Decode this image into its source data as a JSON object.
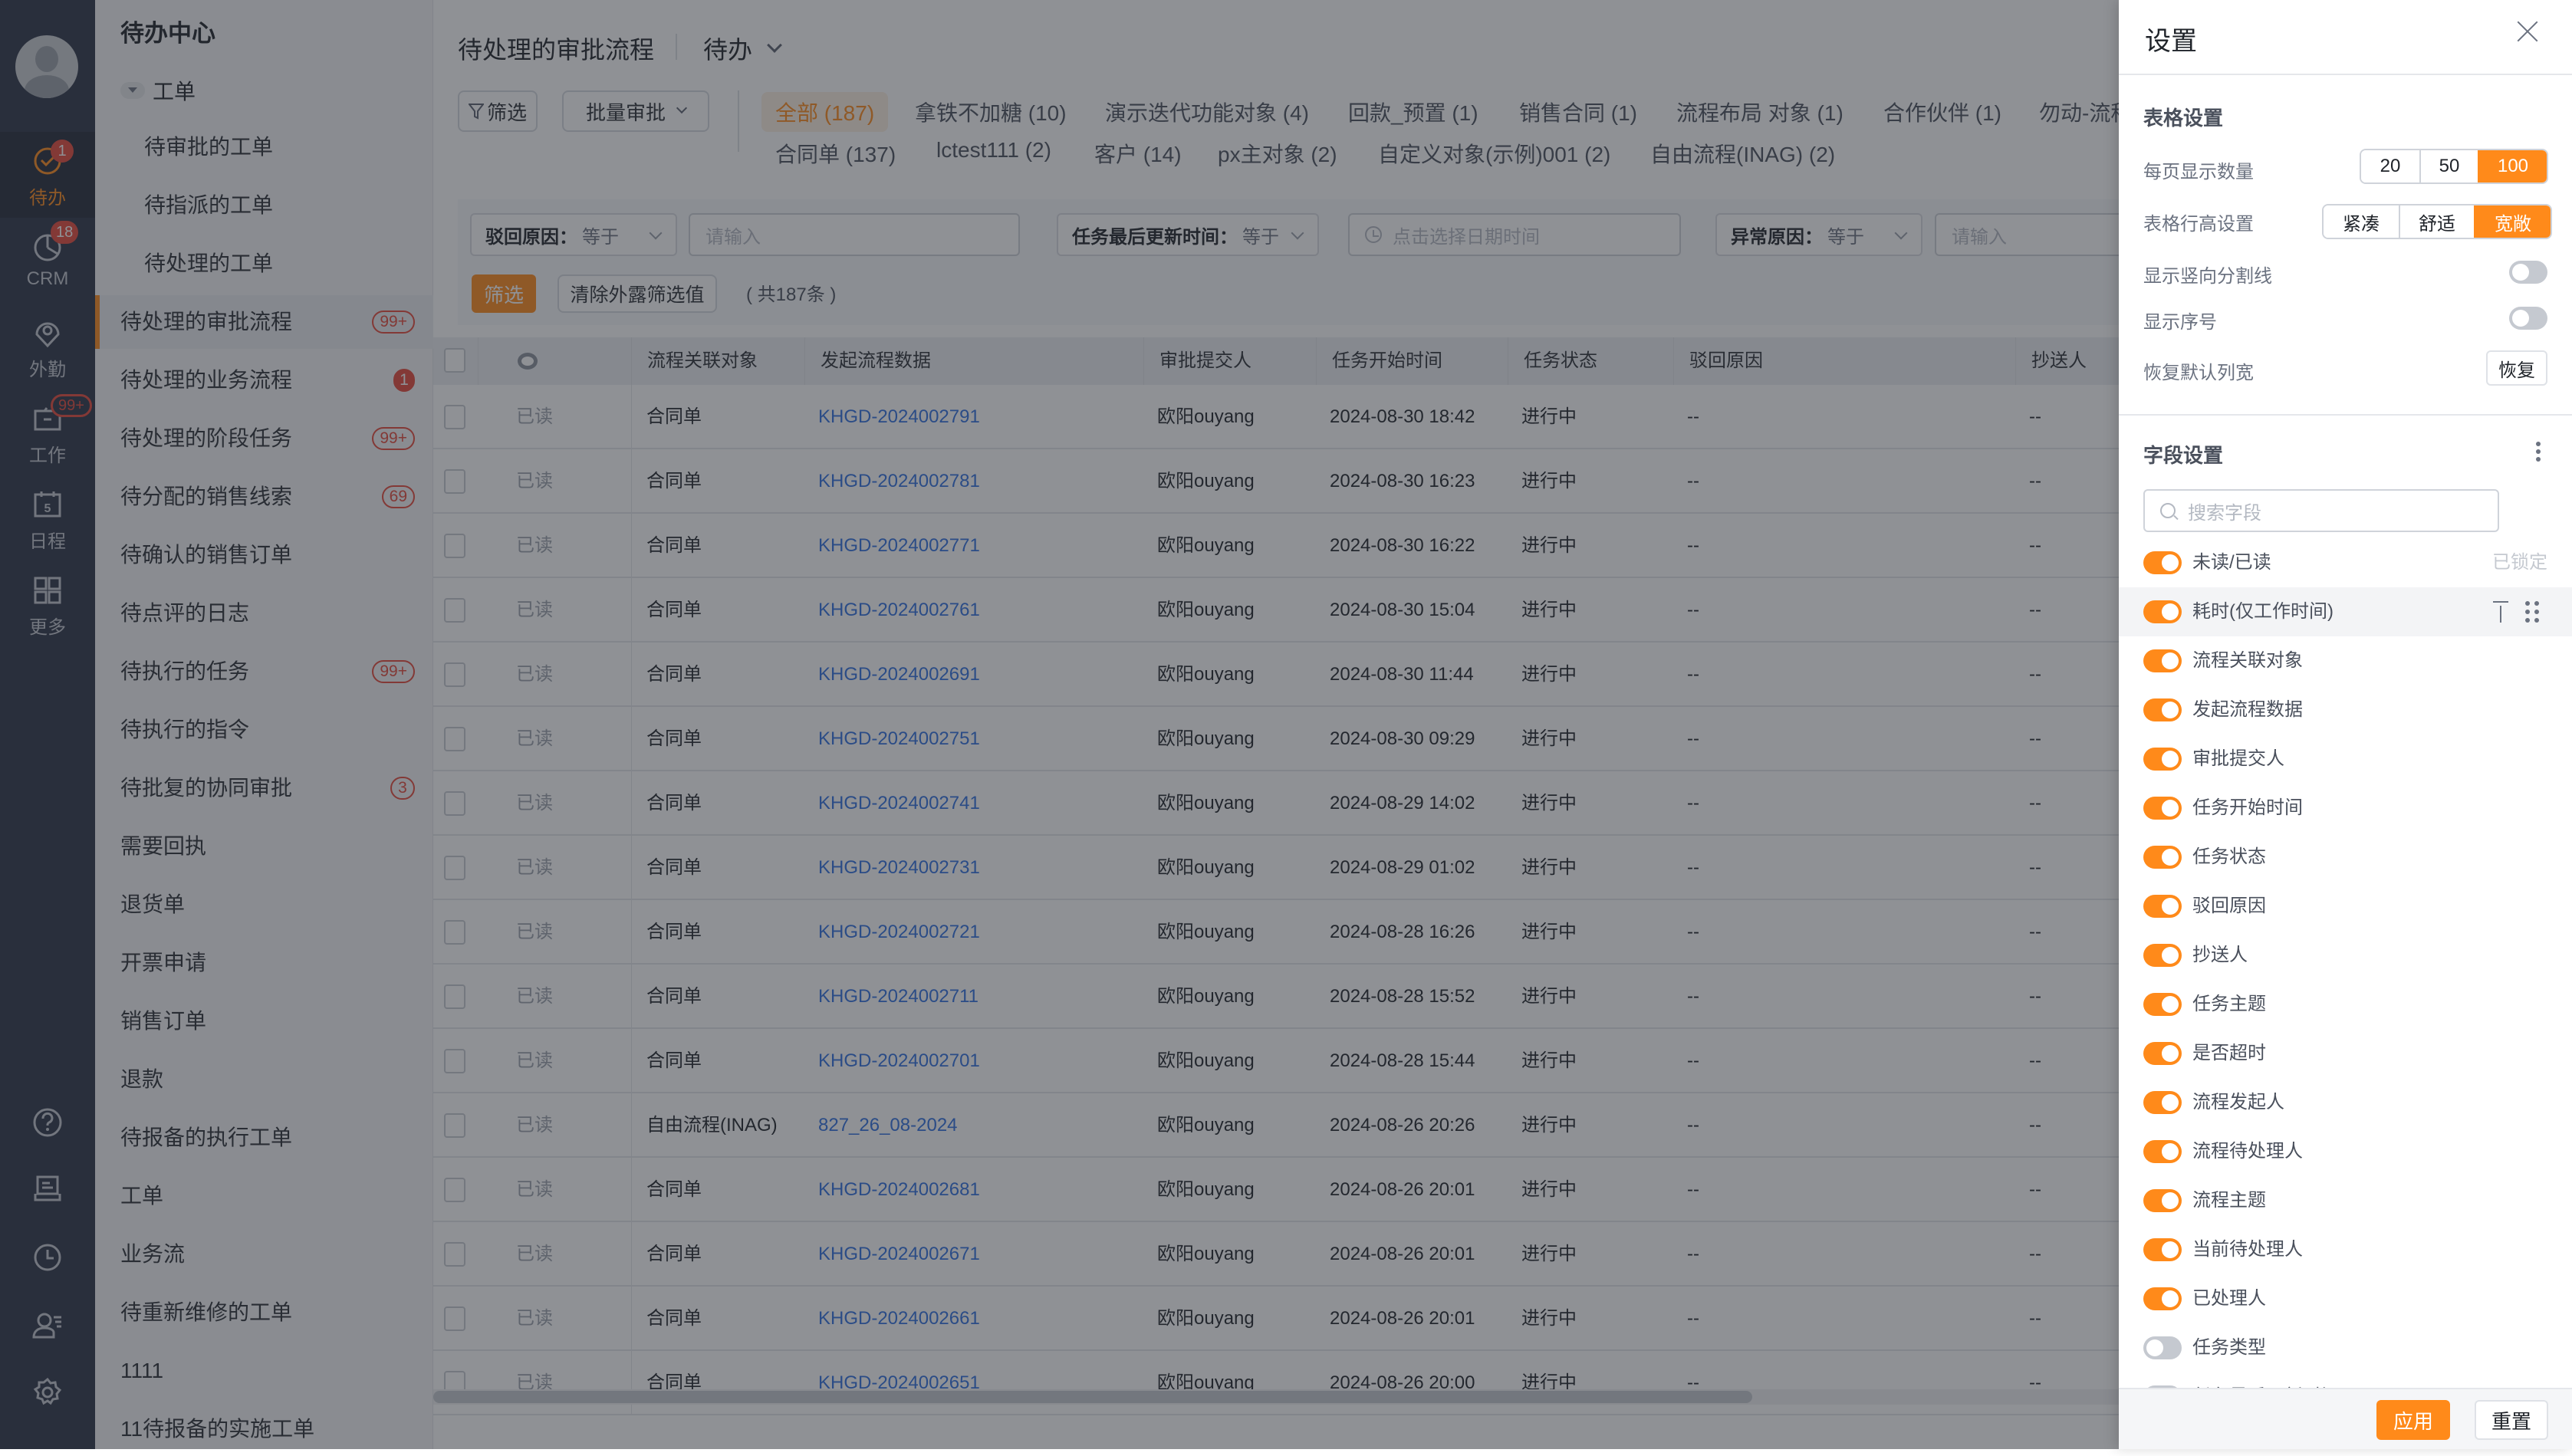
{
  "rail": {
    "items": [
      {
        "label": "待办",
        "icon": "check-circle-icon",
        "badge": "1",
        "active": true
      },
      {
        "label": "CRM",
        "icon": "pie-chart-icon",
        "badge": "18"
      },
      {
        "label": "外勤",
        "icon": "location-pin-icon",
        "badge": null
      },
      {
        "label": "工作",
        "icon": "briefcase-icon",
        "badge": "99+"
      },
      {
        "label": "日程",
        "icon": "calendar-icon",
        "badge": null,
        "calendar_day": "5"
      },
      {
        "label": "更多",
        "icon": "grid-icon",
        "badge": null
      }
    ],
    "bottom_icons": [
      "help-icon",
      "inbox-icon",
      "history-clock-icon",
      "contacts-icon",
      "settings-gear-icon"
    ]
  },
  "nav": {
    "title": "待办中心",
    "group": "工单",
    "sub_items": [
      "待审批的工单",
      "待指派的工单",
      "待处理的工单"
    ],
    "items": [
      {
        "label": "待处理的审批流程",
        "badge": "99+",
        "active": true
      },
      {
        "label": "待处理的业务流程",
        "badge": "1",
        "solid": true
      },
      {
        "label": "待处理的阶段任务",
        "badge": "99+"
      },
      {
        "label": "待分配的销售线索",
        "badge": "69"
      },
      {
        "label": "待确认的销售订单",
        "badge": null
      },
      {
        "label": "待点评的日志",
        "badge": null
      },
      {
        "label": "待执行的任务",
        "badge": "99+"
      },
      {
        "label": "待执行的指令",
        "badge": null
      },
      {
        "label": "待批复的协同审批",
        "badge": "3"
      },
      {
        "label": "需要回执",
        "badge": null
      },
      {
        "label": "退货单",
        "badge": null
      },
      {
        "label": "开票申请",
        "badge": null
      },
      {
        "label": "销售订单",
        "badge": null
      },
      {
        "label": "退款",
        "badge": null
      },
      {
        "label": "待报备的执行工单",
        "badge": null
      },
      {
        "label": "工单",
        "badge": null
      },
      {
        "label": "业务流",
        "badge": null
      },
      {
        "label": "待重新维修的工单",
        "badge": null
      },
      {
        "label": "1111",
        "badge": null
      },
      {
        "label": "11待报备的实施工单",
        "badge": null
      }
    ]
  },
  "header": {
    "title": "待处理的审批流程",
    "view": "待办"
  },
  "toolbar": {
    "filter_label": "筛选",
    "batch_label": "批量审批"
  },
  "tabs": {
    "row1": [
      "全部 (187)",
      "拿铁不加糖 (10)",
      "演示迭代功能对象 (4)",
      "回款_预置 (1)",
      "销售合同 (1)",
      "流程布局 对象 (1)",
      "合作伙伴 (1)",
      "勿动-流程"
    ],
    "row2": [
      "合同单 (137)",
      "lctest111 (2)",
      "客户 (14)",
      "px主对象 (2)",
      "自定义对象(示例)001 (2)",
      "自由流程(INAG) (2)"
    ]
  },
  "filters": {
    "f1": {
      "field": "驳回原因：",
      "op": "等于",
      "placeholder": "请输入"
    },
    "f2": {
      "field": "任务最后更新时间：",
      "op": "等于",
      "placeholder": "点击选择日期时间"
    },
    "f3": {
      "field": "异常原因：",
      "op": "等于",
      "placeholder": "请输入"
    },
    "apply_label": "筛选",
    "clear_label": "清除外露筛选值",
    "total": "( 共187条 )"
  },
  "table": {
    "columns": [
      "流程关联对象",
      "发起流程数据",
      "审批提交人",
      "任务开始时间",
      "任务状态",
      "驳回原因",
      "抄送人"
    ],
    "rows": [
      {
        "read": "已读",
        "object": "合同单",
        "data": "KHGD-2024002791",
        "submitter": "欧阳ouyang",
        "start": "2024-08-30 18:42",
        "status": "进行中",
        "reason": "--",
        "cc": "--"
      },
      {
        "read": "已读",
        "object": "合同单",
        "data": "KHGD-2024002781",
        "submitter": "欧阳ouyang",
        "start": "2024-08-30 16:23",
        "status": "进行中",
        "reason": "--",
        "cc": "--"
      },
      {
        "read": "已读",
        "object": "合同单",
        "data": "KHGD-2024002771",
        "submitter": "欧阳ouyang",
        "start": "2024-08-30 16:22",
        "status": "进行中",
        "reason": "--",
        "cc": "--"
      },
      {
        "read": "已读",
        "object": "合同单",
        "data": "KHGD-2024002761",
        "submitter": "欧阳ouyang",
        "start": "2024-08-30 15:04",
        "status": "进行中",
        "reason": "--",
        "cc": "--"
      },
      {
        "read": "已读",
        "object": "合同单",
        "data": "KHGD-2024002691",
        "submitter": "欧阳ouyang",
        "start": "2024-08-30 11:44",
        "status": "进行中",
        "reason": "--",
        "cc": "--"
      },
      {
        "read": "已读",
        "object": "合同单",
        "data": "KHGD-2024002751",
        "submitter": "欧阳ouyang",
        "start": "2024-08-30 09:29",
        "status": "进行中",
        "reason": "--",
        "cc": "--"
      },
      {
        "read": "已读",
        "object": "合同单",
        "data": "KHGD-2024002741",
        "submitter": "欧阳ouyang",
        "start": "2024-08-29 14:02",
        "status": "进行中",
        "reason": "--",
        "cc": "--"
      },
      {
        "read": "已读",
        "object": "合同单",
        "data": "KHGD-2024002731",
        "submitter": "欧阳ouyang",
        "start": "2024-08-29 01:02",
        "status": "进行中",
        "reason": "--",
        "cc": "--"
      },
      {
        "read": "已读",
        "object": "合同单",
        "data": "KHGD-2024002721",
        "submitter": "欧阳ouyang",
        "start": "2024-08-28 16:26",
        "status": "进行中",
        "reason": "--",
        "cc": "--"
      },
      {
        "read": "已读",
        "object": "合同单",
        "data": "KHGD-2024002711",
        "submitter": "欧阳ouyang",
        "start": "2024-08-28 15:52",
        "status": "进行中",
        "reason": "--",
        "cc": "--"
      },
      {
        "read": "已读",
        "object": "合同单",
        "data": "KHGD-2024002701",
        "submitter": "欧阳ouyang",
        "start": "2024-08-28 15:44",
        "status": "进行中",
        "reason": "--",
        "cc": "--"
      },
      {
        "read": "已读",
        "object": "自由流程(INAG)",
        "data": "827_26_08-2024",
        "submitter": "欧阳ouyang",
        "start": "2024-08-26 20:26",
        "status": "进行中",
        "reason": "--",
        "cc": "--"
      },
      {
        "read": "已读",
        "object": "合同单",
        "data": "KHGD-2024002681",
        "submitter": "欧阳ouyang",
        "start": "2024-08-26 20:01",
        "status": "进行中",
        "reason": "--",
        "cc": "--"
      },
      {
        "read": "已读",
        "object": "合同单",
        "data": "KHGD-2024002671",
        "submitter": "欧阳ouyang",
        "start": "2024-08-26 20:01",
        "status": "进行中",
        "reason": "--",
        "cc": "--"
      },
      {
        "read": "已读",
        "object": "合同单",
        "data": "KHGD-2024002661",
        "submitter": "欧阳ouyang",
        "start": "2024-08-26 20:01",
        "status": "进行中",
        "reason": "--",
        "cc": "--"
      },
      {
        "read": "已读",
        "object": "合同单",
        "data": "KHGD-2024002651",
        "submitter": "欧阳ouyang",
        "start": "2024-08-26 20:00",
        "status": "进行中",
        "reason": "--",
        "cc": "--"
      }
    ]
  },
  "settings": {
    "title": "设置",
    "table_section": "表格设置",
    "page_size": {
      "label": "每页显示数量",
      "options": [
        "20",
        "50",
        "100"
      ],
      "selected": "100"
    },
    "row_height": {
      "label": "表格行高设置",
      "options": [
        "紧凑",
        "舒适",
        "宽敞"
      ],
      "selected": "宽敞"
    },
    "vertical_lines": {
      "label": "显示竖向分割线",
      "on": false
    },
    "show_index": {
      "label": "显示序号",
      "on": false
    },
    "restore_width": {
      "label": "恢复默认列宽",
      "button": "恢复"
    },
    "field_section": "字段设置",
    "search_placeholder": "搜索字段",
    "fields": [
      {
        "label": "未读/已读",
        "on": true,
        "locked": "已锁定"
      },
      {
        "label": "耗时(仅工作时间)",
        "on": true,
        "hover": true
      },
      {
        "label": "流程关联对象",
        "on": true
      },
      {
        "label": "发起流程数据",
        "on": true
      },
      {
        "label": "审批提交人",
        "on": true
      },
      {
        "label": "任务开始时间",
        "on": true
      },
      {
        "label": "任务状态",
        "on": true
      },
      {
        "label": "驳回原因",
        "on": true
      },
      {
        "label": "抄送人",
        "on": true
      },
      {
        "label": "任务主题",
        "on": true
      },
      {
        "label": "是否超时",
        "on": true
      },
      {
        "label": "流程发起人",
        "on": true
      },
      {
        "label": "流程待处理人",
        "on": true
      },
      {
        "label": "流程主题",
        "on": true
      },
      {
        "label": "当前待处理人",
        "on": true
      },
      {
        "label": "已处理人",
        "on": true
      },
      {
        "label": "任务类型",
        "on": false
      },
      {
        "label": "任务最后更新时间",
        "on": false
      }
    ],
    "apply_label": "应用",
    "reset_label": "重置"
  },
  "colors": {
    "accent": "#ff8a1a",
    "badge": "#e5483a",
    "link": "#2f6fe0",
    "rail": "#2b3245"
  }
}
